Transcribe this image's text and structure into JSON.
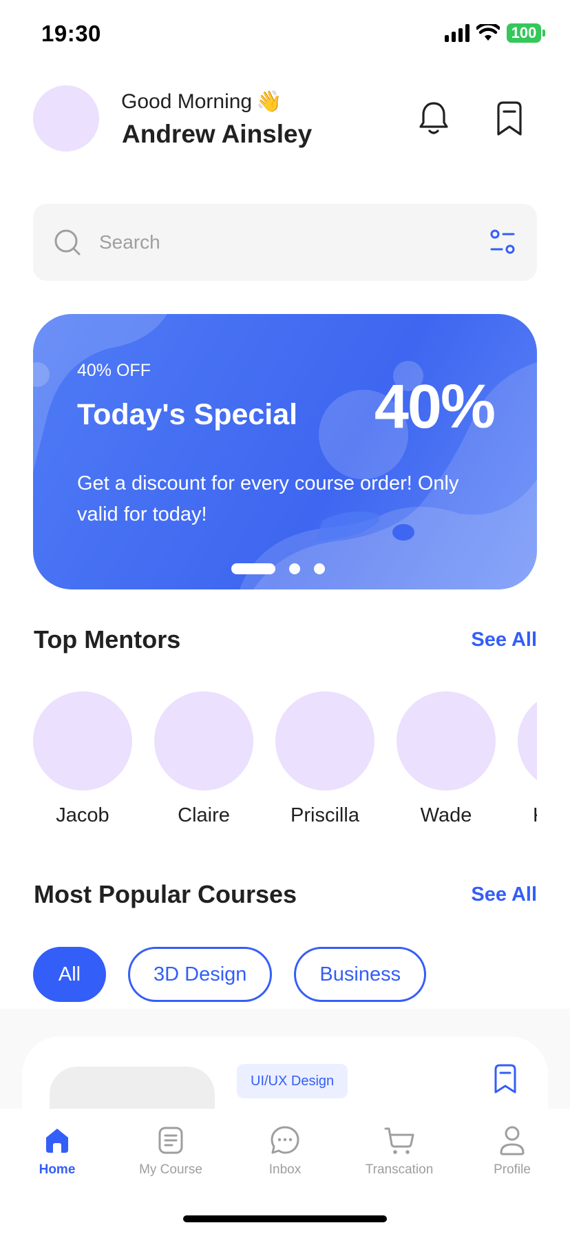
{
  "status_bar": {
    "time": "19:30",
    "battery": "100"
  },
  "header": {
    "greeting": "Good Morning",
    "greeting_emoji": "👋",
    "username": "Andrew Ainsley",
    "icons": [
      "bell-icon",
      "bookmark-icon"
    ]
  },
  "search": {
    "placeholder": "Search",
    "value": "",
    "icons": [
      "search-icon",
      "filter-icon"
    ]
  },
  "banner": {
    "discount_label": "40% OFF",
    "title": "Today's Special",
    "percent": "40%",
    "description": "Get a discount for every course order! Only valid for today!",
    "page_count": 3,
    "active_page": 1
  },
  "mentors_section": {
    "title": "Top Mentors",
    "see_all": "See All",
    "mentors": [
      "Jacob",
      "Claire",
      "Priscilla",
      "Wade",
      "Kathryn"
    ]
  },
  "courses_section": {
    "title": "Most Popular Courses",
    "see_all": "See All",
    "filters": [
      "All",
      "3D Design",
      "Business"
    ],
    "active_filter": "All",
    "card": {
      "tag": "UI/UX Design"
    }
  },
  "bottom_nav": {
    "items": [
      {
        "label": "Home",
        "icon": "home-icon",
        "active": true
      },
      {
        "label": "My Course",
        "icon": "document-icon",
        "active": false
      },
      {
        "label": "Inbox",
        "icon": "chat-icon",
        "active": false
      },
      {
        "label": "Transcation",
        "icon": "cart-icon",
        "active": false
      },
      {
        "label": "Profile",
        "icon": "profile-icon",
        "active": false
      }
    ]
  },
  "colors": {
    "primary": "#335ef7",
    "avatar_placeholder": "#ebe0fd",
    "battery": "#34c759",
    "text": "#212121",
    "muted": "#9e9e9e"
  }
}
